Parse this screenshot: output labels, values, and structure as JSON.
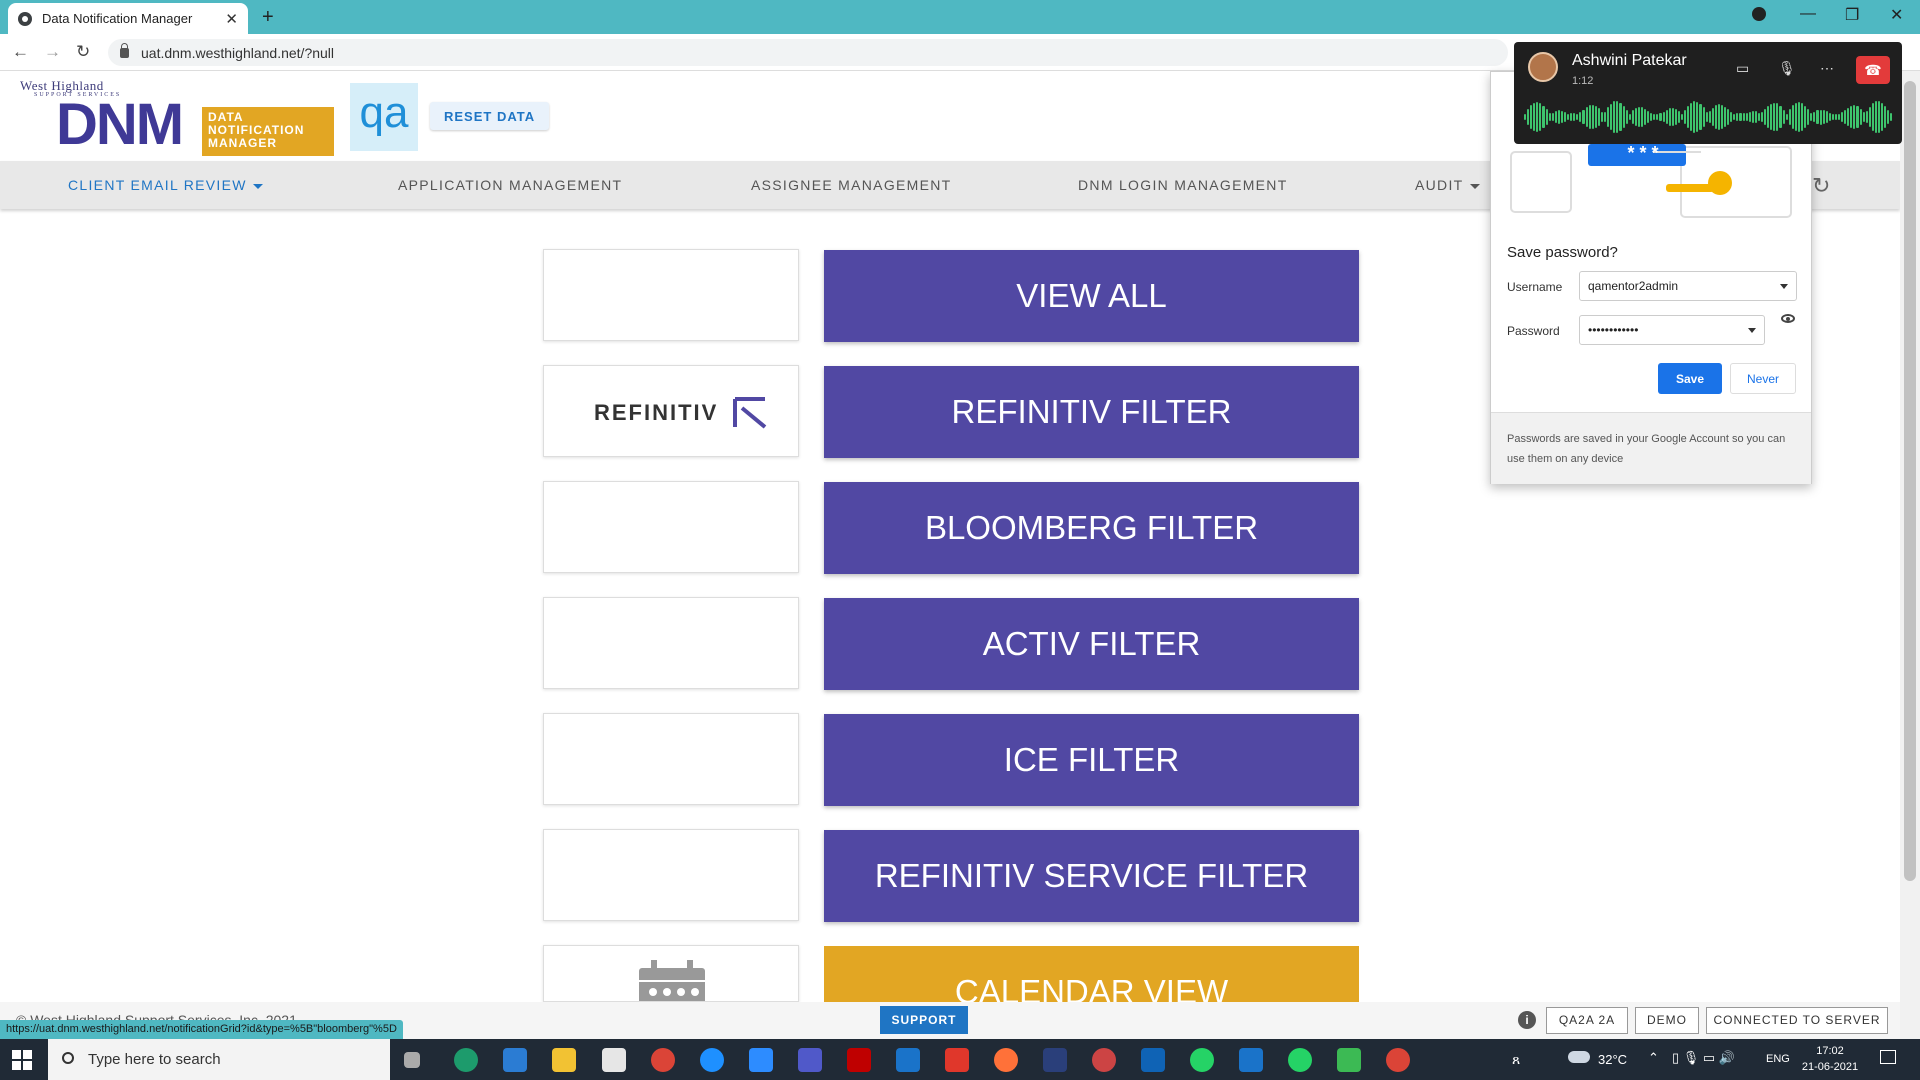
{
  "browser": {
    "tab_title": "Data Notification Manager",
    "url": "uat.dnm.westhighland.net/?null",
    "status_url": "https://uat.dnm.westhighland.net/notificationGrid?id&type=%5B\"bloomberg\"%5D"
  },
  "header": {
    "company_name": "West Highland",
    "company_sub": "SUPPORT SERVICES",
    "logo_text": "DNM",
    "logo_tag_lines": [
      "DATA",
      "NOTIFICATION",
      "MANAGER"
    ],
    "env_badge": "qa",
    "reset_label": "RESET DATA"
  },
  "nav": {
    "items": [
      {
        "label": "CLIENT EMAIL REVIEW",
        "dropdown": true,
        "active": true
      },
      {
        "label": "APPLICATION MANAGEMENT"
      },
      {
        "label": "ASSIGNEE MANAGEMENT"
      },
      {
        "label": "DNM LOGIN MANAGEMENT"
      },
      {
        "label": "AUDIT",
        "dropdown": true
      }
    ]
  },
  "tiles": [
    {
      "label": "VIEW ALL",
      "logo": ""
    },
    {
      "label": "REFINITIV FILTER",
      "logo": "REFINITIV"
    },
    {
      "label": "BLOOMBERG FILTER",
      "logo": ""
    },
    {
      "label": "ACTIV FILTER",
      "logo": ""
    },
    {
      "label": "ICE FILTER",
      "logo": ""
    },
    {
      "label": "REFINITIV SERVICE FILTER",
      "logo": ""
    },
    {
      "label": "CALENDAR VIEW",
      "logo": "calendar-icon"
    }
  ],
  "footer": {
    "copyright": "© West Highland Support Services, Inc. 2021",
    "support_label": "SUPPORT",
    "user_badge": "QA2A 2A",
    "mode_badge": "DEMO",
    "connection_status": "CONNECTED TO SERVER"
  },
  "password_popup": {
    "title": "Save password?",
    "username_label": "Username",
    "username_value": "qamentor2admin",
    "password_label": "Password",
    "password_value": "••••••••••••",
    "save_label": "Save",
    "never_label": "Never",
    "footnote": "Passwords are saved in your Google Account so you can use them on any device",
    "masked_hint": "* * *"
  },
  "call": {
    "caller": "Ashwini Patekar",
    "duration": "1:12"
  },
  "taskbar": {
    "search_placeholder": "Type here to search",
    "temperature": "32°C",
    "language": "ENG",
    "time": "17:02",
    "date": "21-06-2021"
  },
  "colors": {
    "primary_tile": "#5148a3",
    "calendar_tile": "#e2a623",
    "accent_blue": "#1f75c4",
    "browser_teal": "#4fb8c2"
  }
}
